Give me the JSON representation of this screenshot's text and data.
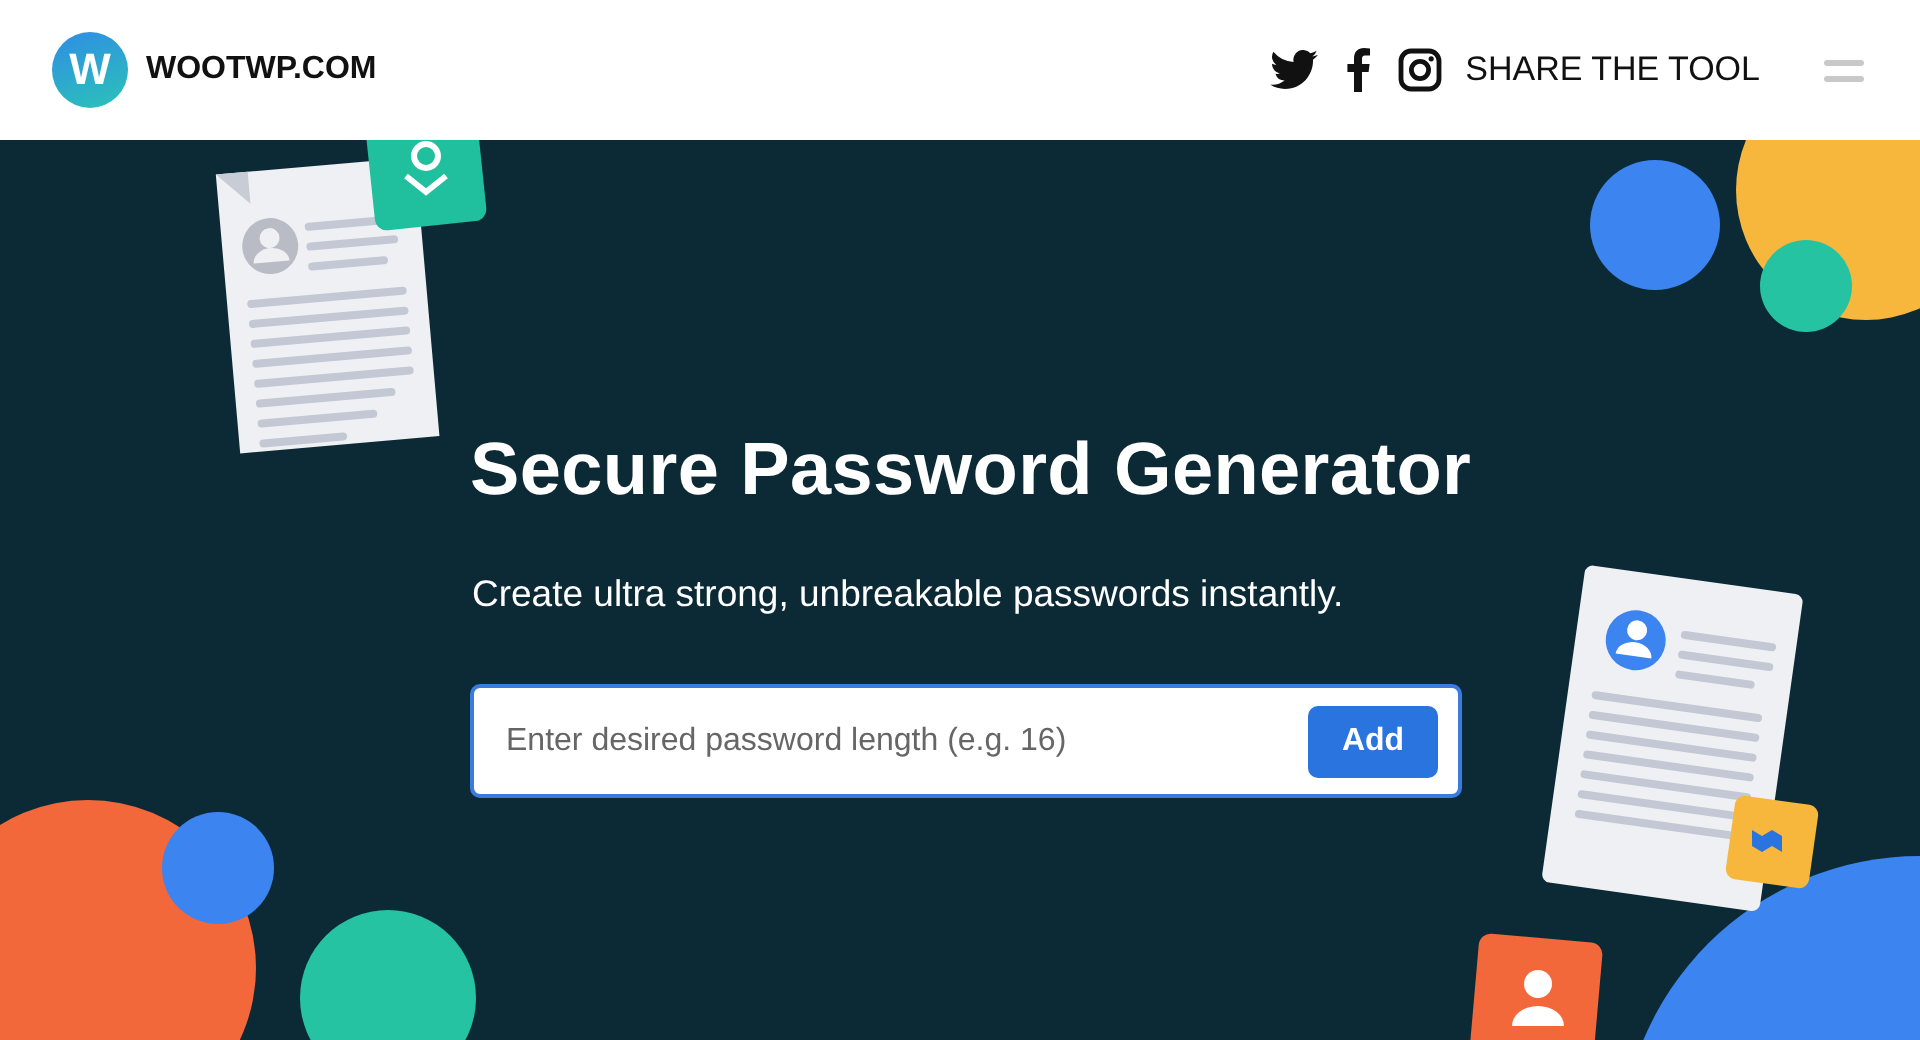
{
  "header": {
    "logo_letter": "W",
    "site_name": "WOOTWP.COM",
    "share_label": "SHARE THE TOOL"
  },
  "hero": {
    "title": "Secure Password Generator",
    "subtitle": "Create ultra strong, unbreakable passwords instantly.",
    "field": {
      "placeholder": "Enter desired password length (e.g. 16)"
    },
    "button": "Add"
  }
}
